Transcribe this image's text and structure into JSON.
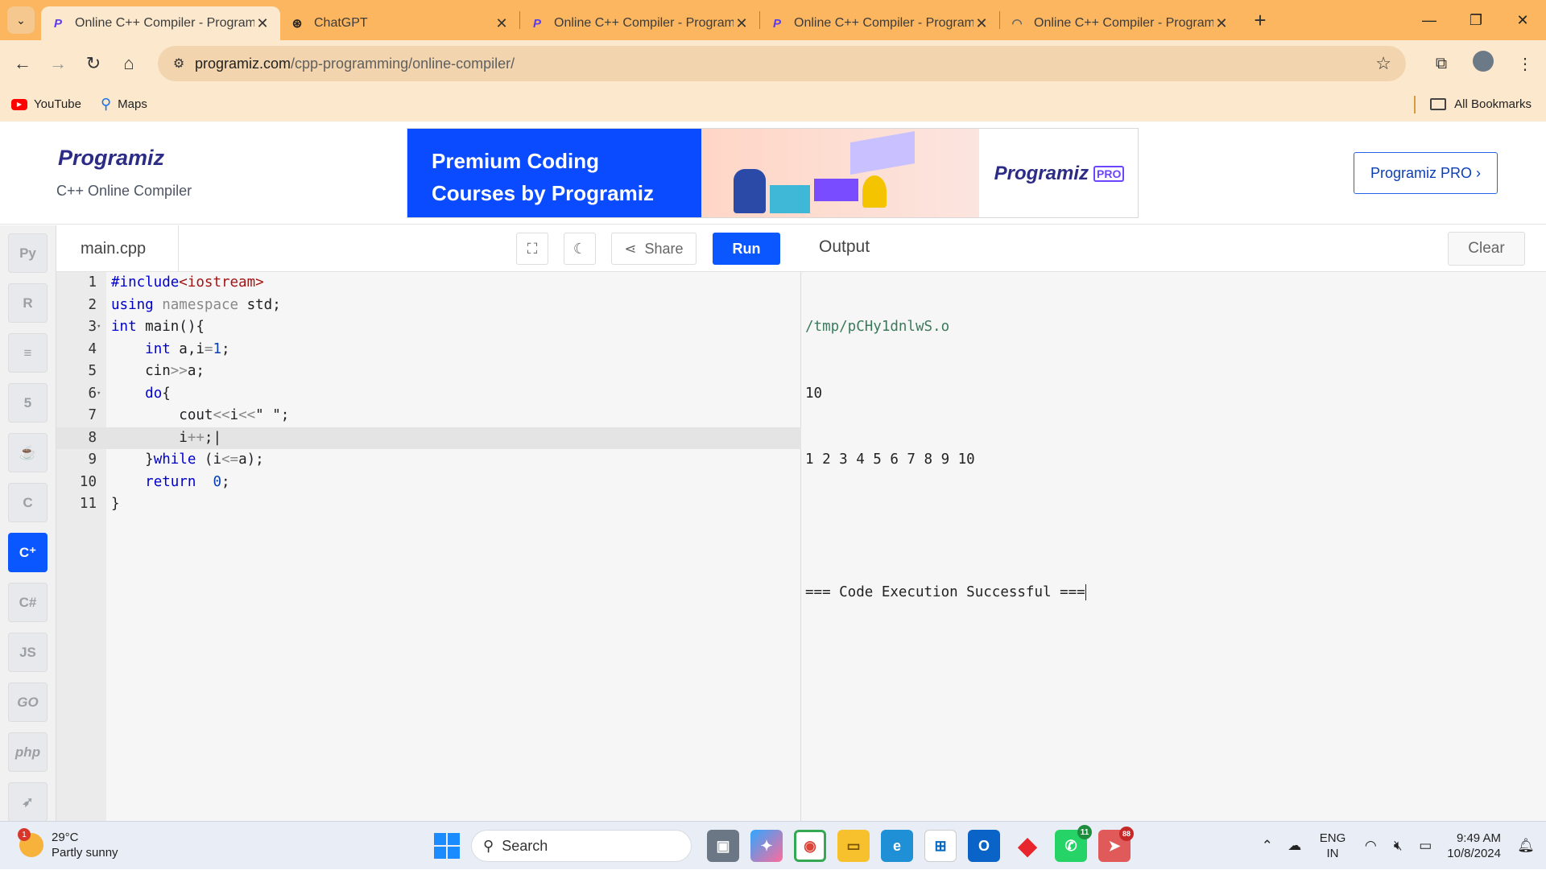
{
  "browser": {
    "tabs": [
      {
        "title": "Online C++ Compiler - Program",
        "icon": "programiz-icon",
        "active": true
      },
      {
        "title": "ChatGPT",
        "icon": "chatgpt-icon",
        "active": false
      },
      {
        "title": "Online C++ Compiler - Program",
        "icon": "programiz-icon",
        "active": false
      },
      {
        "title": "Online C++ Compiler - Program",
        "icon": "programiz-icon",
        "active": false
      },
      {
        "title": "Online C++ Compiler - Program",
        "icon": "loading-icon",
        "active": false
      }
    ],
    "url_host": "programiz.com",
    "url_path": "/cpp-programming/online-compiler/",
    "bookmarks": [
      "YouTube",
      "Maps"
    ],
    "all_bookmarks": "All Bookmarks"
  },
  "site": {
    "logo": "Programiz",
    "subtitle": "C++ Online Compiler",
    "banner_line1": "Premium Coding",
    "banner_line2": "Courses by Programiz",
    "banner_brand": "Programiz",
    "banner_pro": "PRO",
    "pro_button": "Programiz PRO ›"
  },
  "sidebar": {
    "languages": [
      "python-icon",
      "r-icon",
      "sql-icon",
      "html5-icon",
      "java-icon",
      "c-icon",
      "cpp-icon",
      "csharp-icon",
      "JS",
      "GO",
      "php",
      "swift-icon"
    ],
    "active": "cpp-icon"
  },
  "editor": {
    "filename": "main.cpp",
    "share_label": "Share",
    "run_label": "Run",
    "highlighted_line": 8,
    "lines": [
      "#include<iostream>",
      "using namespace std;",
      "int main(){",
      "    int a,i=1;",
      "    cin>>a;",
      "    do{",
      "        cout<<i<<\" \";",
      "        i++;",
      "    }while (i<=a);",
      "    return  0;",
      "}"
    ]
  },
  "output": {
    "title": "Output",
    "clear_label": "Clear",
    "path": "/tmp/pCHy1dnlwS.o",
    "input": "10",
    "result": "1 2 3 4 5 6 7 8 9 10",
    "status": "=== Code Execution Successful ==="
  },
  "taskbar": {
    "weather_temp": "29°C",
    "weather_desc": "Partly sunny",
    "weather_badge": "1",
    "search_label": "Search",
    "whatsapp_badge": "11",
    "telegram_badge": "88",
    "lang_line1": "ENG",
    "lang_line2": "IN",
    "time": "9:49 AM",
    "date": "10/8/2024"
  }
}
